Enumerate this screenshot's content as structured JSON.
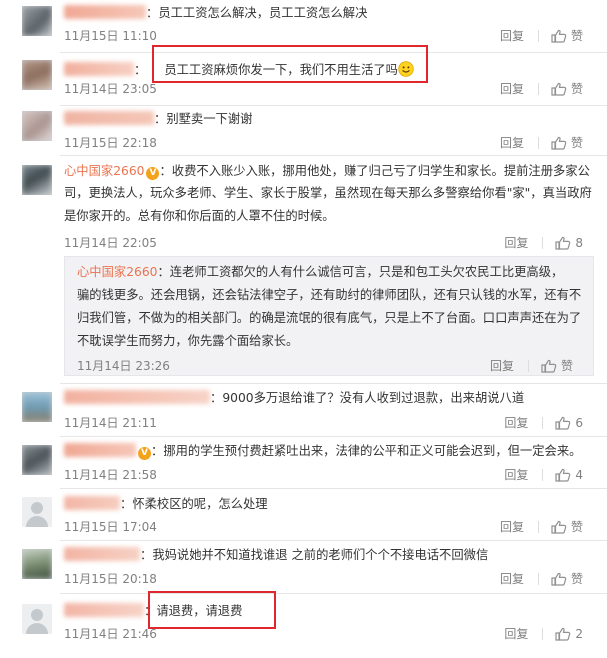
{
  "comments": [
    {
      "username": "",
      "text": "员工工资怎么解决，员工工资怎么解决",
      "time": "11月15日 11:10",
      "reply": "回复",
      "like": "赞"
    },
    {
      "username": "",
      "text": "员工工资麻烦你发一下，我们不用生活了吗",
      "time": "11月14日 23:05",
      "reply": "回复",
      "like": "赞"
    },
    {
      "username": "",
      "text": "别墅卖一下谢谢",
      "time": "11月15日 22:18",
      "reply": "回复",
      "like": "赞"
    },
    {
      "username": "心中国家2660",
      "text_l1": "收费不入账少入账，挪用他处，赚了归己亏了归学生和家长。提前注册多家公",
      "text_l2": "司，更换法人，玩众多老师、学生、家长于股掌，虽然现在每天那么多警察给你看\"家\"，真当政府",
      "text_l3": "是你家开的。总有你和你后面的人罩不住的时候。",
      "time": "11月14日 22:05",
      "reply": "回复",
      "like": "8"
    },
    {
      "username": "心中国家2660",
      "text_l1": "连老师工资都欠的人有什么诚信可言，只是和包工头欠农民工比更高级，",
      "text_l2": "骗的钱更多。还会甩锅，还会钻法律空子，还有助纣的律师团队，还有只认钱的水军，还有不",
      "text_l3": "归我们管，不做为的相关部门。的确是流氓的很有底气，只是上不了台面。口口声声还在为了",
      "text_l4": "不耽误学生而努力，你先露个面给家长。",
      "time": "11月14日 23:26",
      "reply": "回复",
      "like": "赞"
    },
    {
      "username": "",
      "text": "9000多万退给谁了？没有人收到过退款，出来胡说八道",
      "time": "11月14日 21:11",
      "reply": "回复",
      "like": "6"
    },
    {
      "username": "",
      "text": "挪用的学生预付费赶紧吐出来，法律的公平和正义可能会迟到，但一定会来。",
      "time": "11月14日 21:58",
      "reply": "回复",
      "like": "4"
    },
    {
      "username": "",
      "text": "怀柔校区的呢，怎么处理",
      "time": "11月15日 17:04",
      "reply": "回复",
      "like": "赞"
    },
    {
      "username": "",
      "text": "我妈说她并不知道找谁退 之前的老师们个个不接电话不回微信",
      "time": "11月15日 20:18",
      "reply": "回复",
      "like": "赞"
    },
    {
      "username": "",
      "text": "请退费，请退费",
      "time": "11月14日 21:46",
      "reply": "回复",
      "like": "2"
    }
  ],
  "icons": {
    "thumb": "thumbs-up-icon",
    "verified": "verified-v-icon",
    "smiley": "smiley-emoji-icon"
  },
  "verified_glyph": "V",
  "colors": {
    "username": "#eb7350",
    "highlight": "#e0262e",
    "meta": "#808080",
    "nested_bg": "#f2f2f5"
  }
}
